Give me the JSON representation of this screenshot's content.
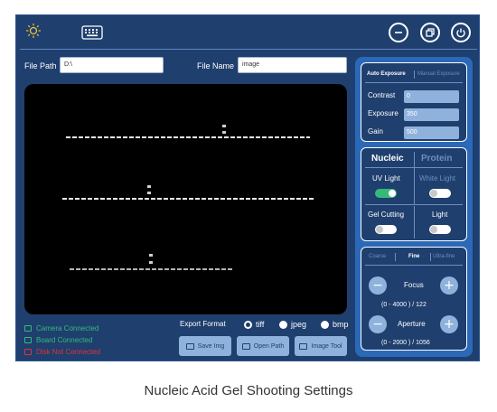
{
  "file_path": {
    "label": "File Path",
    "value": "D:\\"
  },
  "file_name": {
    "label": "File Name",
    "value": "image"
  },
  "status": {
    "camera": "Camera Connected",
    "board": "Board Connected",
    "disk": "Disk Not Connected"
  },
  "export": {
    "label": "Export Format",
    "options": [
      "tiff",
      "jpeg",
      "bmp"
    ],
    "selected": "tiff"
  },
  "buttons": {
    "save": "Save Img",
    "open": "Open Path",
    "tool": "Image Tool"
  },
  "exposure_panel": {
    "tabs": [
      "Auto Exposure",
      "Manual Exposure"
    ],
    "active_tab": "Auto Exposure",
    "contrast": {
      "label": "Contrast",
      "value": "0"
    },
    "exposure": {
      "label": "Exposure",
      "value": "350"
    },
    "gain": {
      "label": "Gain",
      "value": "500"
    }
  },
  "mode_panel": {
    "nucleic": "Nucleic",
    "protein": "Protein",
    "uv_light": {
      "label": "UV Light",
      "on": true
    },
    "white_light": {
      "label": "White Light",
      "on": false
    },
    "gel_cutting": {
      "label": "Gel Cutting",
      "on": false
    },
    "light": {
      "label": "Light",
      "on": false
    }
  },
  "focus_panel": {
    "tabs": [
      "Coarse",
      "Fine",
      "Ultra-fine"
    ],
    "active_tab": "Fine",
    "focus": {
      "label": "Focus",
      "range": "(0 - 4000 )",
      "sep": "/",
      "value": "122"
    },
    "aperture": {
      "label": "Aperture",
      "range": "(0 - 2000 )",
      "sep": "/",
      "value": "1056"
    }
  },
  "caption": "Nucleic Acid Gel Shooting Settings",
  "colors": {
    "window_bg": "#1f3f6e",
    "panel_bg": "#2b69b8",
    "connected": "#35b97b",
    "disconnected": "#e0323c",
    "toggle_on": "#35b97b"
  },
  "icons": {
    "top_left": [
      "sun-icon",
      "keyboard-icon"
    ],
    "top_right": [
      "minimize-icon",
      "restore-icon",
      "power-icon"
    ]
  }
}
